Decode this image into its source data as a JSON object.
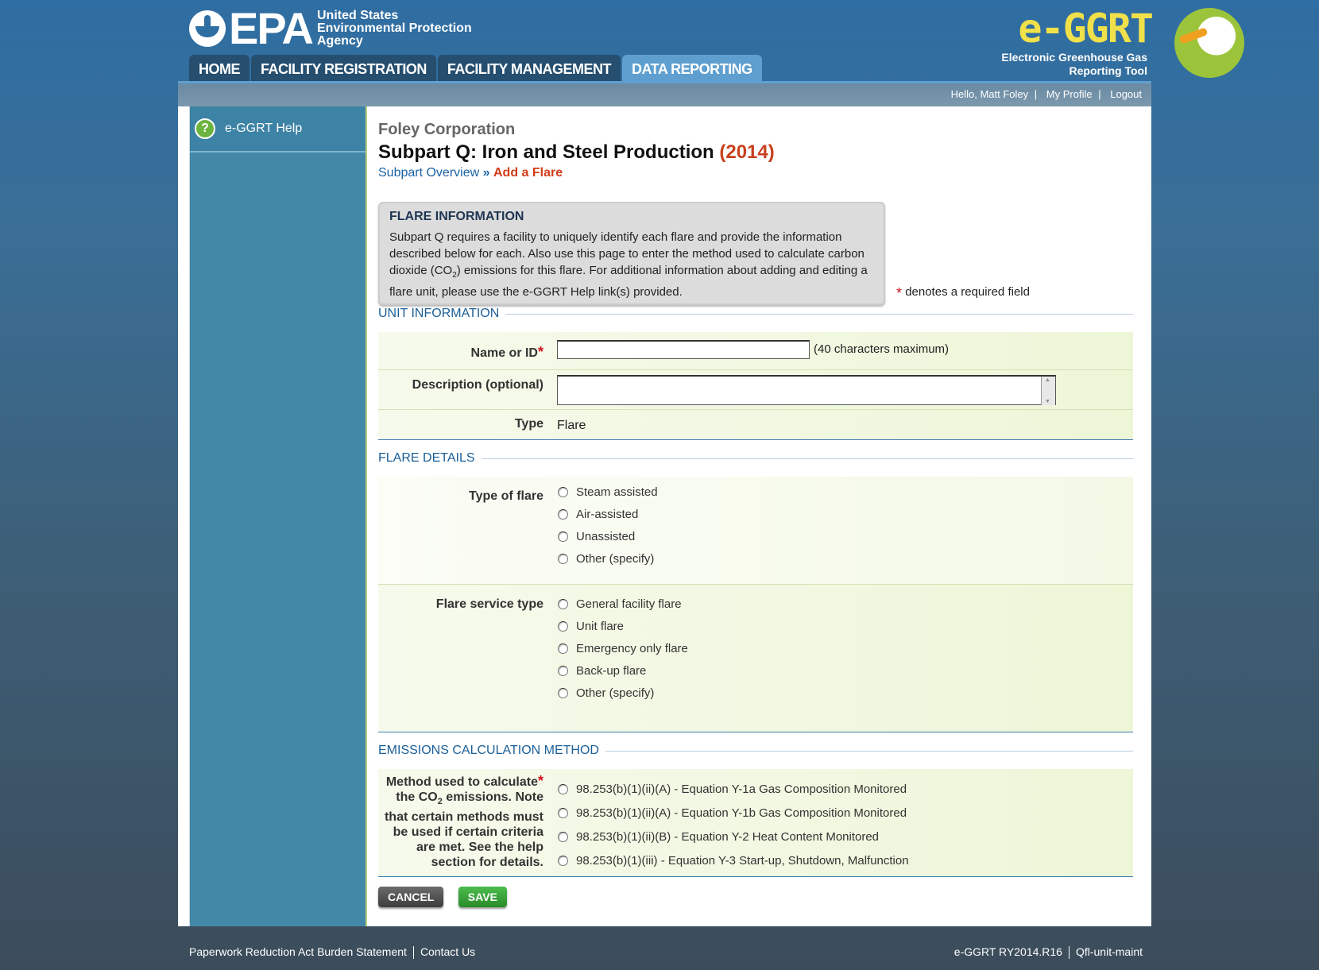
{
  "header": {
    "epa_word": "EPA",
    "epa_agency": [
      "United States",
      "Environmental Protection",
      "Agency"
    ],
    "app_title": "e-GGRT",
    "app_subtitle": [
      "Electronic Greenhouse Gas",
      "Reporting Tool"
    ]
  },
  "nav": {
    "tabs": [
      {
        "label": "HOME"
      },
      {
        "label": "FACILITY REGISTRATION"
      },
      {
        "label": "FACILITY MANAGEMENT"
      },
      {
        "label": "DATA REPORTING",
        "active": true
      }
    ]
  },
  "userbar": {
    "greeting": "Hello, Matt Foley",
    "profile": "My Profile",
    "logout": "Logout",
    "separator": "|"
  },
  "sidebar": {
    "help_label": "e-GGRT Help",
    "help_icon": "?"
  },
  "page": {
    "company": "Foley Corporation",
    "title": "Subpart Q: Iron and Steel Production",
    "year": "(2014)",
    "breadcrumb_link": "Subpart Overview",
    "breadcrumb_sep": "»",
    "breadcrumb_current": "Add a Flare"
  },
  "info": {
    "title": "FLARE INFORMATION",
    "text_before_sub": "Subpart Q requires a facility to uniquely identify each flare and provide the information described below for each. Also use this page to enter the method used to calculate carbon dioxide (CO",
    "sub": "2",
    "text_after_sub": ") emissions for this flare. For additional information about adding and editing a flare unit, please use the e-GGRT Help link(s) provided."
  },
  "required_note": {
    "star": "*",
    "text": "denotes a required field"
  },
  "unit_info": {
    "heading": "UNIT INFORMATION",
    "name_label": "Name or ID",
    "name_value": "",
    "name_hint": "(40 characters maximum)",
    "desc_label": "Description (optional)",
    "desc_value": "",
    "type_label": "Type",
    "type_value": "Flare"
  },
  "flare_details": {
    "heading": "FLARE DETAILS",
    "type_label": "Type of flare",
    "type_options": [
      "Steam assisted",
      "Air-assisted",
      "Unassisted",
      "Other (specify)"
    ],
    "service_label": "Flare service type",
    "service_options": [
      "General facility flare",
      "Unit flare",
      "Emergency only flare",
      "Back-up flare",
      "Other (specify)"
    ]
  },
  "emissions": {
    "heading": "EMISSIONS CALCULATION METHOD",
    "label_lines": [
      "Method used to calculate",
      "the CO",
      "2",
      " emissions. Note",
      "that certain methods must",
      "be used if certain criteria",
      "are met. See the help",
      "section for details."
    ],
    "options": [
      "98.253(b)(1)(ii)(A) - Equation Y-1a Gas Composition Monitored",
      "98.253(b)(1)(ii)(A) - Equation Y-1b Gas Composition Monitored",
      "98.253(b)(1)(ii)(B) - Equation Y-2 Heat Content Monitored",
      "98.253(b)(1)(iii) - Equation Y-3 Start-up, Shutdown, Malfunction"
    ]
  },
  "buttons": {
    "cancel": "CANCEL",
    "save": "SAVE"
  },
  "footer": {
    "paperwork": "Paperwork Reduction Act Burden Statement",
    "contact": "Contact Us",
    "version": "e-GGRT RY2014.R16",
    "page_id": "Qfl-unit-maint"
  },
  "colors": {
    "accent_red": "#d23c18",
    "link_blue": "#1b62a6",
    "required_red": "#d0141e"
  }
}
